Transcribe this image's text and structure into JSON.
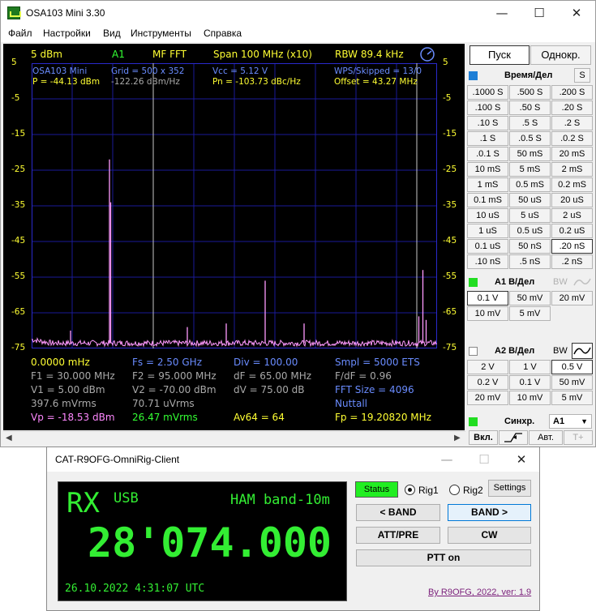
{
  "osa_window": {
    "title": "OSA103 Mini 3.30",
    "controls": {
      "minimize": "—",
      "maximize": "☐",
      "close": "✕"
    },
    "menu": [
      "Файл",
      "Настройки",
      "Вид",
      "Инструменты",
      "Справка"
    ]
  },
  "plot": {
    "header": {
      "level": "5 dBm",
      "channel": "A1",
      "mode": "MF FFT",
      "span": "Span 100 MHz (x10)",
      "rbw": "RBW 89.4 kHz"
    },
    "info_row1": {
      "device": "OSA103 Mini",
      "grid": "Grid = 500 x 352",
      "vcc": "Vcc = 5.12 V",
      "wps": "WPS/Skipped = 13/0"
    },
    "info_row2": {
      "p": "P = -44.13 dBm",
      "density": "-122.26 dBm/Hz",
      "pn": "Pn = -103.73 dBc/Hz",
      "offset": "Offset = 43.27 MHz"
    },
    "y_ticks": [
      "5",
      "-5",
      "-15",
      "-25",
      "-35",
      "-45",
      "-55",
      "-65",
      "-75"
    ],
    "footer": {
      "r1": [
        "0.0000 mHz",
        "Fs = 2.50 GHz",
        "Div = 100.00",
        "Smpl = 5000 ETS"
      ],
      "r2": [
        "F1 = 30.000 MHz",
        "F2 = 95.000 MHz",
        "dF = 65.00 MHz",
        "F/dF = 0.96"
      ],
      "r3": [
        "V1 = 5.00 dBm",
        "V2 = -70.00 dBm",
        "dV = 75.00 dB",
        "FFT Size = 4096"
      ],
      "r4": [
        "397.6 mVrms",
        "70.71 uVrms",
        "Nuttall"
      ],
      "r5": [
        "Vp = -18.53 dBm",
        "26.47 mVrms",
        "Av64 = 64",
        "Fp = 19.20820 MHz"
      ]
    },
    "colors": {
      "background": "#000000",
      "grid": "#1a1a99",
      "trace": "#ff99ff",
      "cursor": "#c8c8c8"
    }
  },
  "chart_data": {
    "type": "line",
    "title": "",
    "xlabel": "",
    "ylabel": "",
    "xlim": [
      0,
      100
    ],
    "ylim": [
      -75,
      5
    ],
    "x_unit": "MHz",
    "y_unit": "dBm",
    "noise_floor": -73.5,
    "series": [
      {
        "peaks": [
          {
            "x": 19.2,
            "y": -22
          },
          {
            "x": 19.5,
            "y": -34
          },
          {
            "x": 9.6,
            "y": -70
          },
          {
            "x": 38.4,
            "y": -69
          },
          {
            "x": 48.0,
            "y": -68
          },
          {
            "x": 57.6,
            "y": -56
          },
          {
            "x": 67.2,
            "y": -68
          },
          {
            "x": 95.5,
            "y": -66
          },
          {
            "x": 96.5,
            "y": -53
          },
          {
            "x": 97.3,
            "y": -67
          }
        ]
      }
    ],
    "cursors_x": [
      30,
      95
    ]
  },
  "panel": {
    "start": "Пуск",
    "single": "Однокр.",
    "time_label": "Время/Дел",
    "time_s": "S",
    "time_buttons": [
      [
        ".1000 S",
        ".500 S",
        ".200 S"
      ],
      [
        ".100 S",
        ".50 S",
        ".20 S"
      ],
      [
        ".10 S",
        ".5 S",
        ".2 S"
      ],
      [
        ".1 S",
        ".0.5 S",
        ".0.2 S"
      ],
      [
        ".0.1 S",
        "50 mS",
        "20 mS"
      ],
      [
        "10 mS",
        "5 mS",
        "2 mS"
      ],
      [
        "1 mS",
        "0.5 mS",
        "0.2 mS"
      ],
      [
        "0.1 mS",
        "50 uS",
        "20 uS"
      ],
      [
        "10 uS",
        "5 uS",
        "2 uS"
      ],
      [
        "1 uS",
        "0.5 uS",
        "0.2 uS"
      ],
      [
        "0.1 uS",
        "50 nS",
        ".20 nS"
      ],
      [
        ".10 nS",
        ".5 nS",
        ".2 nS"
      ]
    ],
    "a1_label": "A1 В/Дел",
    "a1_bw": "BW",
    "a1_buttons": [
      [
        "0.1 V",
        "50 mV",
        "20 mV"
      ],
      [
        "10 mV",
        "5 mV"
      ]
    ],
    "a2_label": "A2 В/Дел",
    "a2_bw": "BW",
    "a2_buttons": [
      [
        "2 V",
        "1 V",
        "0.5 V"
      ],
      [
        "0.2 V",
        "0.1 V",
        "50 mV"
      ],
      [
        "20 mV",
        "10 mV",
        "5 mV"
      ]
    ],
    "sync_label": "Синхр.",
    "sync_value": "A1",
    "bottom_buttons": [
      "Вкл.",
      "Авт.",
      "T+"
    ],
    "colors": {
      "channel_a1": "#22dd22",
      "time_marker": "#1e7fd6",
      "sync_marker": "#22dd22"
    }
  },
  "cat_window": {
    "title": "CAT-R9OFG-OmniRig-Client",
    "controls": {
      "minimize": "—",
      "maximize": "☐",
      "close": "✕"
    },
    "display": {
      "rx": "RX",
      "mode": "USB",
      "band": "HAM band-10m",
      "frequency": "28'074.000",
      "datetime": "26.10.2022  4:31:07 UTC"
    },
    "status": "Status",
    "rig1": "Rig1",
    "rig2": "Rig2",
    "settings": "Settings",
    "band_down": "< BAND",
    "band_up": "BAND >",
    "att": "ATT/PRE",
    "cw": "CW",
    "ptt": "PTT on",
    "credit": "By R9OFG, 2022, ver: 1.9",
    "colors": {
      "status_bg": "#22ee22",
      "display_text": "#33ee33",
      "credit": "#7a1f7a"
    }
  }
}
